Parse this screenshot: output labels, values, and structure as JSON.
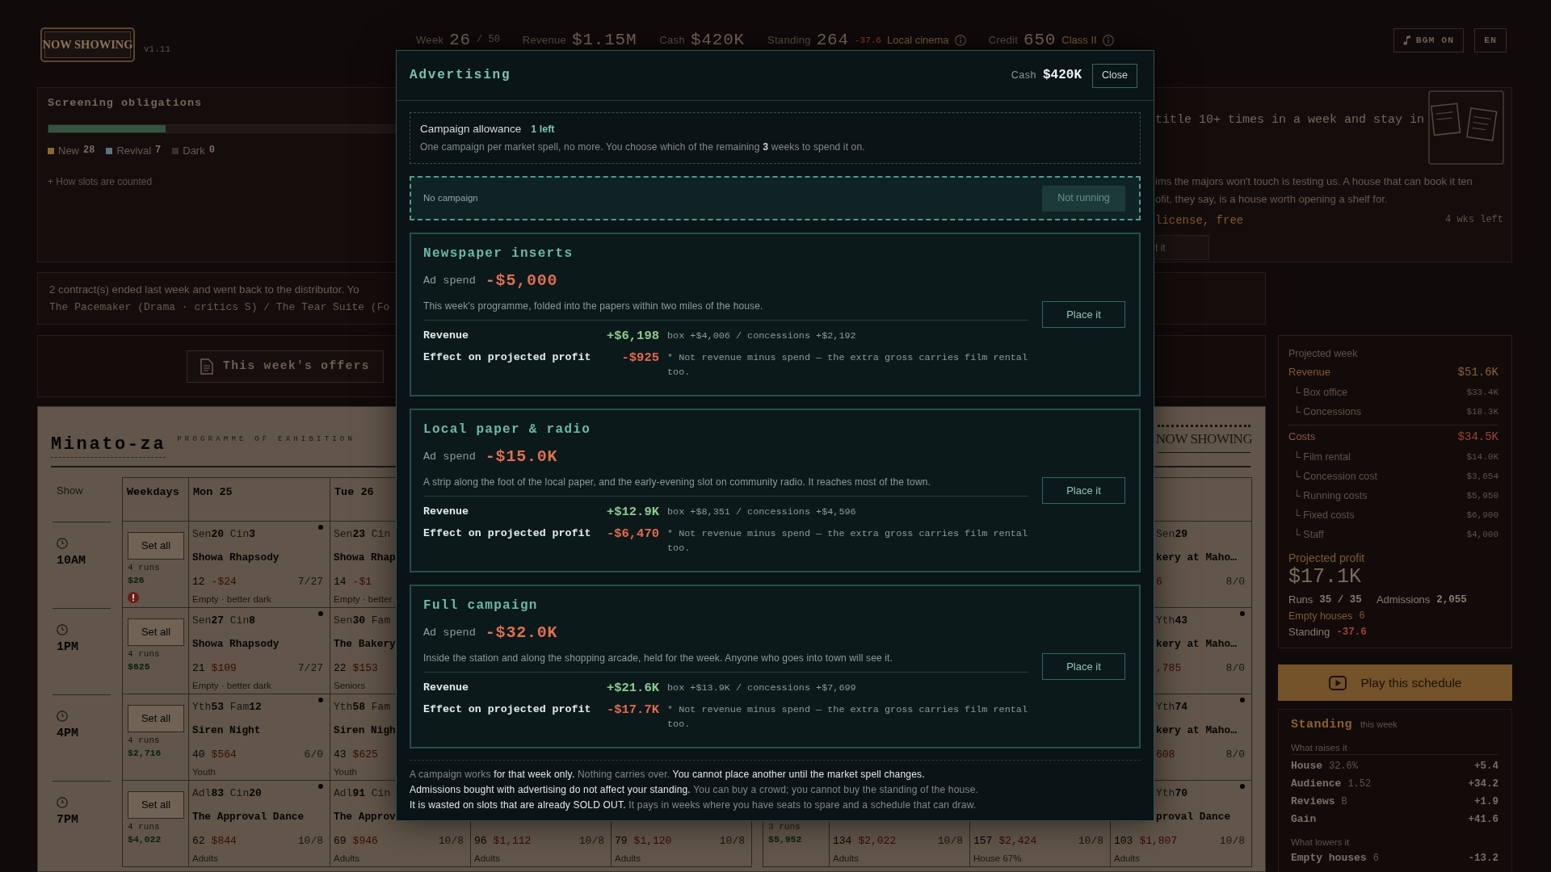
{
  "top_bar": {
    "logo": "NOW SHOWING",
    "version": "v1.11",
    "stats": [
      {
        "label": "Week",
        "value": "26",
        "suffix": "/ 50"
      },
      {
        "label": "Revenue",
        "value": "$1.15M"
      },
      {
        "label": "Cash",
        "value": "$420K"
      },
      {
        "label": "Standing",
        "value": "264",
        "delta": "-37.6",
        "note": "Local cinema",
        "info": true
      },
      {
        "label": "Credit",
        "value": "650",
        "note": "Class II",
        "info": true
      }
    ],
    "buttons": [
      {
        "label": "BGM ON",
        "kind": "music"
      },
      {
        "label": "EN",
        "kind": "plain"
      }
    ]
  },
  "obligations": {
    "title": "Screening obligations",
    "level": 0.33,
    "legend": [
      {
        "label": "New",
        "value": "28",
        "color": "#8a6a2c"
      },
      {
        "label": "Revival",
        "value": "7",
        "color": "#587480"
      },
      {
        "label": "Dark",
        "value": "0",
        "color": "#3d2f2a"
      }
    ],
    "link": "+ How slots are counted"
  },
  "offer": {
    "headline": "title 10+ times in a week and stay in",
    "body": [
      "ims the majors won't touch is testing us. A house that can book it ten",
      "ofit, they say, is a house worth opening a shelf for."
    ],
    "terms": "license, free",
    "time_left": "4 wks left",
    "button": "t it"
  },
  "notice": {
    "message": "2 contract(s) ended last week and went back to the distributor. Yo",
    "titles": "The Pacemaker (Drama · critics S) / The Tear Suite (Fo"
  },
  "offers_button": "This week's offers",
  "timetable": {
    "title": "Minato-za",
    "subtitle": "PROGRAMME OF EXHIBITION",
    "logo": "NOW SHOWING",
    "show_heading": "Show",
    "times": [
      "10AM",
      "1PM",
      "4PM",
      "7PM"
    ],
    "groups": [
      {
        "heading": "Weekdays",
        "rows": [
          {
            "button": "Set all",
            "runs": "4 runs",
            "total": "$26",
            "warning": true
          },
          {
            "button": "Set all",
            "runs": "4 runs",
            "total": "$625",
            "warning": false
          },
          {
            "button": "Set all",
            "runs": "4 runs",
            "total": "$2,716",
            "warning": false
          },
          {
            "button": "Set all",
            "runs": "4 runs",
            "total": "$4,022",
            "warning": false
          }
        ]
      },
      {
        "rows": [
          null,
          null,
          null,
          {
            "runs": "3 runs",
            "total": "$5,952",
            "warning": false
          }
        ]
      }
    ],
    "days": [
      {
        "heading": "Mon 25",
        "cells": [
          {
            "code": "Sen**20** Cin**3**",
            "film": "Showa Rhapsody",
            "admissions": "12",
            "take": "-$24",
            "ratio": "7/27",
            "note": "Empty · better dark",
            "dot": true
          },
          {
            "code": "Sen**27** Cin**8**",
            "film": "Showa Rhapsody",
            "admissions": "21",
            "take": "$109",
            "ratio": "7/27",
            "note": "Empty · better dark",
            "dot": true
          },
          {
            "code": "Yth**53** Fam**12**",
            "film": "Siren Night",
            "admissions": "40",
            "take": "$564",
            "ratio": "6/0",
            "note": "Youth",
            "dot": true
          },
          {
            "code": "Adl**83** Cin**20**",
            "film": "The Approval Dance",
            "admissions": "62",
            "take": "$844",
            "ratio": "10/8",
            "note": "Adults",
            "dot": true
          }
        ]
      },
      {
        "heading": "Tue 26",
        "cells": [
          {
            "code": "Sen**23** Cin",
            "film": "Showa Rhap",
            "admissions": "14",
            "take": "-$1",
            "note": "Empty · better",
            "dot": false
          },
          {
            "code": "Sen**30** Fam",
            "film": "The Bakery",
            "admissions": "22",
            "take": "$153",
            "note": "Seniors",
            "dot": false
          },
          {
            "code": "Yth**58** Fam",
            "film": "Siren Nigh",
            "admissions": "43",
            "take": "$625",
            "note": "Youth",
            "dot": false
          },
          {
            "code": "Adl**91** Cin",
            "film": "The Approv",
            "admissions": "69",
            "take": "$946",
            "ratio": "10/8",
            "note": "Adults",
            "dot": false
          }
        ]
      },
      {
        "cells": [
          null,
          null,
          null,
          {
            "admissions": "96",
            "take": "$1,112",
            "ratio": "10/8",
            "note": "Adults",
            "dot": false
          }
        ]
      },
      {
        "cells": [
          null,
          null,
          null,
          {
            "admissions": "79",
            "take": "$1,120",
            "ratio": "10/8",
            "note": "Adults",
            "dot": false
          }
        ]
      },
      {
        "cells": [
          null,
          null,
          null,
          {
            "admissions": "134",
            "take": "$2,022",
            "ratio": "10/8",
            "note": "Adults",
            "dot": false
          }
        ]
      },
      {
        "cells": [
          null,
          null,
          null,
          {
            "admissions": "157",
            "take": "$2,424",
            "ratio": "10/8",
            "note": "House 67%",
            "dot": false
          }
        ]
      },
      {
        "cells": [
          {
            "code": "Sen**29**",
            "film": "kery at Maho…",
            "take": "6",
            "ratio": "8/0",
            "dot": false
          },
          {
            "code": "Yth**43**",
            "film": "kery at Maho…",
            "take": ",785",
            "ratio": "8/0",
            "dot": true
          },
          {
            "code": "Yth**74**",
            "film": "kery at Maho…",
            "take": "608",
            "ratio": "8/0",
            "dot": true
          },
          {
            "code": "Yth**70**",
            "film": "proval Dance",
            "admissions": "103",
            "take": "$1,807",
            "ratio": "10/8",
            "note": "Adults",
            "dot": true
          }
        ]
      }
    ]
  },
  "projection": {
    "title": "Projected week",
    "sections": [
      {
        "label": "Revenue",
        "value": "$51.6K",
        "kind": "revenue",
        "items": [
          {
            "label": "└ Box office",
            "value": "$33.4K"
          },
          {
            "label": "└ Concessions",
            "value": "$18.3K"
          }
        ]
      },
      {
        "label": "Costs",
        "value": "$34.5K",
        "kind": "costs",
        "items": [
          {
            "label": "└ Film rental",
            "value": "$14.0K"
          },
          {
            "label": "└ Concession cost",
            "value": "$3,654"
          },
          {
            "label": "└ Running costs",
            "value": "$5,950"
          },
          {
            "label": "└ Fixed costs",
            "value": "$6,900"
          },
          {
            "label": "└ Staff",
            "value": "$4,000"
          }
        ]
      }
    ],
    "profit_label": "Projected profit",
    "profit": "$17.1K",
    "facts": [
      {
        "label": "Runs",
        "value": "35 / 35"
      },
      {
        "label": "Admissions",
        "value": "2,055"
      }
    ],
    "empty": {
      "label": "Empty houses",
      "value": "6"
    },
    "standing": {
      "label": "Standing",
      "value": "-37.6"
    }
  },
  "play_button": "Play this schedule",
  "standing": {
    "title": "Standing",
    "period": "this week",
    "raises_label": "What raises it",
    "raises": [
      {
        "label": "House",
        "detail": "32.6%",
        "value": "+5.4"
      },
      {
        "label": "Audience",
        "detail": "1.52",
        "value": "+34.2"
      },
      {
        "label": "Reviews",
        "detail": "B",
        "value": "+1.9"
      }
    ],
    "gain": {
      "label": "Gain",
      "value": "+41.6"
    },
    "lowers_label": "What lowers it",
    "lowers": [
      {
        "label": "Empty houses",
        "detail": "6",
        "value": "-13.2"
      }
    ]
  },
  "modal": {
    "title": "Advertising",
    "cash_label": "Cash",
    "cash": "$420K",
    "close": "Close",
    "allowance": {
      "label": "Campaign allowance",
      "remaining": "1 left",
      "note": "One campaign per market spell, no more. You choose which of the remaining **3** weeks to spend it on."
    },
    "current": {
      "label": "No campaign",
      "button": "Not running",
      "disabled": true
    },
    "campaigns": [
      {
        "name": "Newspaper inserts",
        "spend_label": "Ad spend",
        "spend": "-$5,000",
        "description": "This week's programme, folded into the papers within two miles of the house.",
        "rows": [
          {
            "label": "Revenue",
            "value": "+$6,198",
            "kind": "gain",
            "detail": "box +$4,006 / concessions +$2,192"
          },
          {
            "label": "Effect on projected profit",
            "value": "-$925",
            "kind": "loss",
            "detail": "* Not revenue minus spend — the extra gross carries film rental too."
          }
        ],
        "button": "Place it"
      },
      {
        "name": "Local paper & radio",
        "spend_label": "Ad spend",
        "spend": "-$15.0K",
        "description": "A strip along the foot of the local paper, and the early-evening slot on community radio. It reaches most of the town.",
        "rows": [
          {
            "label": "Revenue",
            "value": "+$12.9K",
            "kind": "gain",
            "detail": "box +$8,351 / concessions +$4,596"
          },
          {
            "label": "Effect on projected profit",
            "value": "-$6,470",
            "kind": "loss",
            "detail": "* Not revenue minus spend — the extra gross carries film rental too."
          }
        ],
        "button": "Place it"
      },
      {
        "name": "Full campaign",
        "spend_label": "Ad spend",
        "spend": "-$32.0K",
        "description": "Inside the station and along the shopping arcade, held for the week. Anyone who goes into town will see it.",
        "rows": [
          {
            "label": "Revenue",
            "value": "+$21.6K",
            "kind": "gain",
            "detail": "box +$13.9K / concessions +$7,699"
          },
          {
            "label": "Effect on projected profit",
            "value": "-$17.7K",
            "kind": "loss",
            "detail": "* Not revenue minus spend — the extra gross carries film rental too."
          }
        ],
        "button": "Place it"
      }
    ],
    "footer": [
      "A campaign works **for that week only.** Nothing carries over. **You cannot place another until the market spell changes.**",
      "**Admissions bought with advertising do not affect your standing.** You can buy a crowd; you cannot buy the standing of the house.",
      "**It is wasted on slots that are already SOLD OUT.** It pays in weeks where you have seats to spare and a schedule that can draw."
    ]
  }
}
